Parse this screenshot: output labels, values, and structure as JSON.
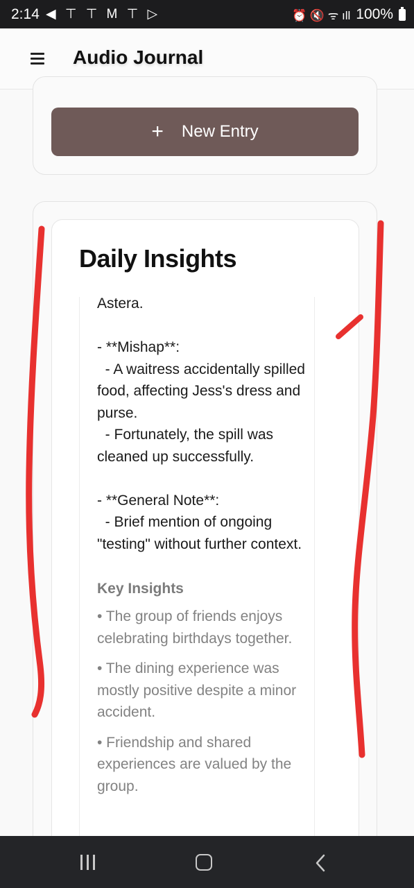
{
  "status_bar": {
    "time": "2:14",
    "notification_icons": "◀ ⊤ ⊤ M ⊤ ▷",
    "right_icons": "⏰ 🔇 ᯤ ıll",
    "battery": "100%"
  },
  "app_bar": {
    "menu_icon": "hamburger-menu-icon",
    "title": "Audio Journal"
  },
  "new_entry_button": {
    "icon": "plus-icon",
    "label": "New Entry",
    "color": "#6f5a58"
  },
  "insights": {
    "title": "Daily Insights",
    "summary_text": "Astera.\n\n- **Mishap**:\n  - A waitress accidentally spilled food, affecting Jess's dress and purse.\n  - Fortunately, the spill was cleaned up successfully.\n\n- **General Note**:\n  - Brief mention of ongoing \"testing\" without further context.",
    "key_heading": "Key Insights",
    "key_items": [
      "• The group of friends enjoys celebrating birthdays together.",
      "• The dining experience was mostly positive despite a minor accident.",
      "• Friendship and shared experiences are valued by the group."
    ]
  },
  "nav_bar": {
    "recent_icon": "recent-apps-icon",
    "home_icon": "home-icon",
    "back_icon": "back-icon"
  },
  "annotation_color": "#e8312f"
}
